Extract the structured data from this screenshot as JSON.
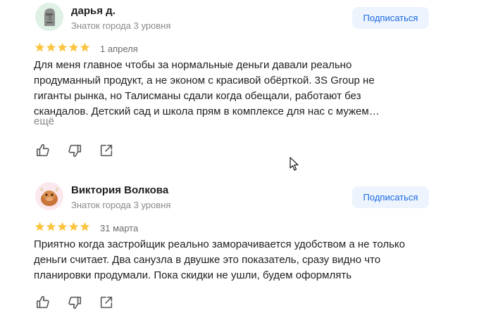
{
  "reviews": [
    {
      "author": "дарья д.",
      "level": "Знаток города 3 уровня",
      "subscribe_label": "Подписаться",
      "rating": 5,
      "date": "1 апреля",
      "text": "Для меня главное чтобы за нормальные деньги давали реально продуманный продукт, а не эконом с красивой обёрткой. 3S Group не гиганты рынка, но Талисманы сдали когда обещали, работают без скандалов. Детский сад и школа прям в комплексе для нас с мужем…",
      "more_label": "ещё"
    },
    {
      "author": "Виктория Волкова",
      "level": "Знаток города 3 уровня",
      "subscribe_label": "Подписаться",
      "rating": 5,
      "date": "31 марта",
      "text": "Приятно когда застройщик реально заморачивается удобством а не только деньги считает. Два санузла в двушке это показатель, сразу видно что планировки продумали. Пока скидки не ушли, будем оформлять"
    }
  ],
  "colors": {
    "star": "#fcc43e",
    "subscribe_bg": "#edf4fe",
    "subscribe_text": "#1b69e0",
    "muted_text": "#898989"
  },
  "icons": [
    "moai-avatar-icon",
    "bull-avatar-icon",
    "like-icon",
    "dislike-icon",
    "share-icon",
    "star-icon",
    "mouse-cursor-icon"
  ]
}
